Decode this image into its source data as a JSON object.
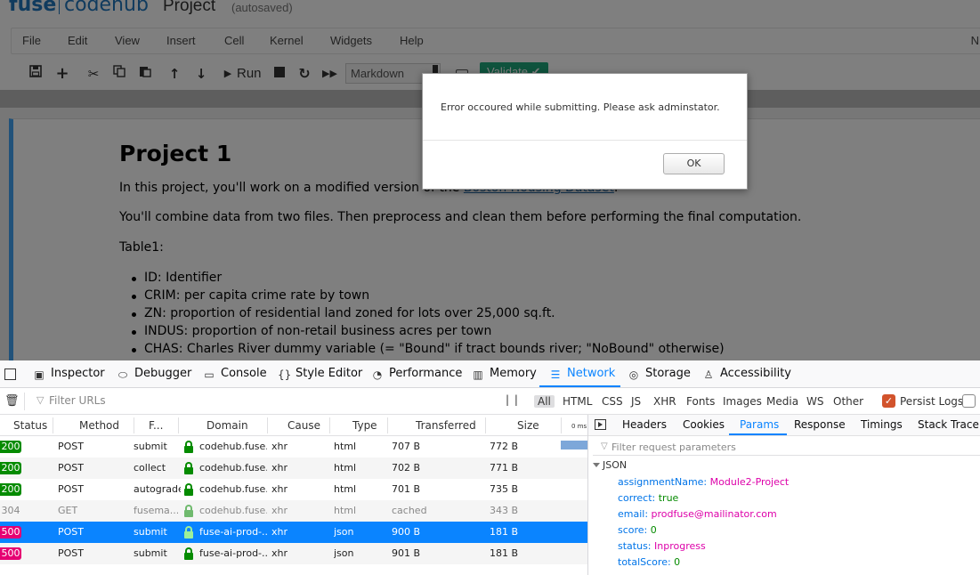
{
  "jupyter": {
    "logo_fuse": "fuse",
    "logo_codehub": "codehub",
    "notebook_name": "Project",
    "save_status": "(autosaved)",
    "menu": [
      "File",
      "Edit",
      "View",
      "Insert",
      "Cell",
      "Kernel",
      "Widgets",
      "Help"
    ],
    "menu_right": "N",
    "toolbar": {
      "run_label": "Run",
      "cell_type": "Markdown",
      "validate_label": "Validate ✔",
      "icons": [
        "save-icon",
        "plus-icon",
        "cut-icon",
        "copy-icon",
        "paste-icon",
        "arrow-up-icon",
        "arrow-down-icon",
        "run-icon",
        "stop-icon",
        "restart-icon",
        "fast-forward-icon",
        "keyboard-icon"
      ]
    },
    "cell": {
      "heading": "Project 1",
      "intro_before": "In this project, you'll work on a modified version of the ",
      "intro_link": "Boston Housing Dataset",
      "intro_after": ".",
      "para2": "You'll combine data from two files. Then preprocess and clean them before performing the final computation.",
      "table_label": "Table1:",
      "items": [
        "ID: Identifier",
        "CRIM: per capita crime rate by town",
        "ZN: proportion of residential land zoned for lots over 25,000 sq.ft.",
        "INDUS: proportion of non-retail business acres per town",
        "CHAS: Charles River dummy variable (= \"Bound\" if tract bounds river; \"NoBound\" otherwise)"
      ]
    }
  },
  "dialog": {
    "message": "Error occoured while submitting. Please ask adminstator.",
    "ok_label": "OK"
  },
  "devtools": {
    "tabs": [
      "Inspector",
      "Debugger",
      "Console",
      "Style Editor",
      "Performance",
      "Memory",
      "Network",
      "Storage",
      "Accessibility"
    ],
    "selected_tab": "Network",
    "filter_placeholder": "Filter URLs",
    "pause_label": "| |",
    "type_filters": [
      "All",
      "HTML",
      "CSS",
      "JS",
      "XHR",
      "Fonts",
      "Images",
      "Media",
      "WS",
      "Other"
    ],
    "persist_logs_label": "Persist Logs",
    "columns": [
      "Status",
      "Method",
      "F...",
      "Domain",
      "Cause",
      "Type",
      "Transferred",
      "Size",
      "0 ms"
    ],
    "requests": [
      {
        "status": "200",
        "method": "POST",
        "file": "submit",
        "domain": "codehub.fuse...",
        "cause": "xhr",
        "type": "html",
        "transferred": "707 B",
        "size": "772 B"
      },
      {
        "status": "200",
        "method": "POST",
        "file": "collect",
        "domain": "codehub.fuse...",
        "cause": "xhr",
        "type": "html",
        "transferred": "702 B",
        "size": "771 B"
      },
      {
        "status": "200",
        "method": "POST",
        "file": "autograde",
        "domain": "codehub.fuse...",
        "cause": "xhr",
        "type": "html",
        "transferred": "701 B",
        "size": "735 B"
      },
      {
        "status": "304",
        "method": "GET",
        "file": "fusema...",
        "domain": "codehub.fuse...",
        "cause": "xhr",
        "type": "html",
        "transferred": "cached",
        "size": "343 B"
      },
      {
        "status": "500",
        "method": "POST",
        "file": "submit",
        "domain": "fuse-ai-prod-...",
        "cause": "xhr",
        "type": "json",
        "transferred": "900 B",
        "size": "181 B"
      },
      {
        "status": "500",
        "method": "POST",
        "file": "submit",
        "domain": "fuse-ai-prod-...",
        "cause": "xhr",
        "type": "json",
        "transferred": "901 B",
        "size": "181 B"
      }
    ],
    "side_tabs": [
      "Headers",
      "Cookies",
      "Params",
      "Response",
      "Timings",
      "Stack Trace"
    ],
    "selected_side_tab": "Params",
    "params_filter_placeholder": "Filter request parameters",
    "json_label": "JSON",
    "params": [
      {
        "key": "assignmentName:",
        "value": "Module2-Project",
        "kind": "string"
      },
      {
        "key": "correct:",
        "value": "true",
        "kind": "bool"
      },
      {
        "key": "email:",
        "value": "prodfuse@mailinator.com",
        "kind": "string"
      },
      {
        "key": "score:",
        "value": "0",
        "kind": "bool"
      },
      {
        "key": "status:",
        "value": "Inprogress",
        "kind": "string"
      },
      {
        "key": "totalScore:",
        "value": "0",
        "kind": "bool"
      }
    ]
  },
  "colors": {
    "brand": "#2176bd",
    "devtools_accent": "#0a84ff",
    "status_ok": "#058b00",
    "status_error": "#e60073",
    "validate_green": "#1fa67a"
  }
}
